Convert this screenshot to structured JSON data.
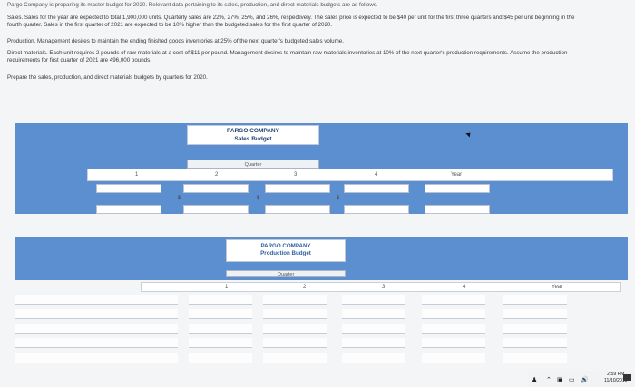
{
  "problem": {
    "intro": "Pargo Company is preparing its master budget for 2020. Relevant data pertaining to its sales, production, and direct materials budgets are as follows.",
    "sales_line1": "Sales. Sales for the year are expected to total 1,900,000 units. Quarterly sales are 22%, 27%, 25%, and 26%, respectively. The sales price is expected to be $40 per unit for the first three quarters and $45 per unit beginning in the",
    "sales_line2": "fourth quarter. Sales in the first quarter of 2021 are expected to be 10% higher than the budgeted sales for the first quarter of 2020.",
    "production": "Production. Management desires to maintain the ending finished goods inventories at 25% of the next quarter's budgeted sales volume.",
    "materials_line1": "Direct materials. Each unit requires 2 pounds of raw materials at a cost of $11 per pound. Management desires to maintain raw materials inventories at 10% of the next quarter's production requirements. Assume the production",
    "materials_line2": "requirements for first quarter of 2021 are 496,000 pounds.",
    "instruction": "Prepare the sales, production, and direct materials budgets by quarters for 2020."
  },
  "sales_budget": {
    "company": "PARGO COMPANY",
    "title": "Sales Budget",
    "quarter_label": "Quarter",
    "col1": "1",
    "col2": "2",
    "col3": "3",
    "col4": "4",
    "year": "Year",
    "currency": "$"
  },
  "production_budget": {
    "company": "PARGO COMPANY",
    "title": "Production Budget",
    "quarter_label": "Quarter",
    "col1": "1",
    "col2": "2",
    "col3": "3",
    "col4": "4",
    "year": "Year"
  },
  "taskbar": {
    "time": "2:59 PM",
    "date": "11/10/2019"
  }
}
